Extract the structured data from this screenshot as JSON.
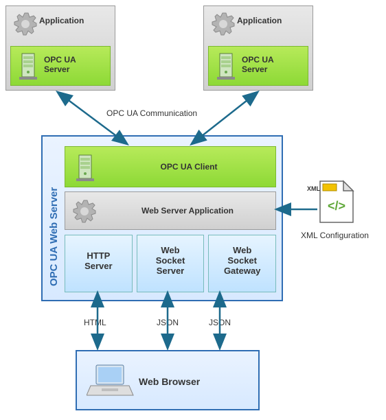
{
  "apps": [
    {
      "label": "Application",
      "server_label": "OPC UA\nServer"
    },
    {
      "label": "Application",
      "server_label": "OPC UA\nServer"
    }
  ],
  "communication_label": "OPC UA Communication",
  "main": {
    "side_title": "OPC UA Web Server",
    "client_label": "OPC UA Client",
    "webapp_label": "Web Server Application",
    "protocols": [
      {
        "name": "HTTP\nServer"
      },
      {
        "name": "Web\nSocket\nServer"
      },
      {
        "name": "Web\nSocket\nGateway"
      }
    ]
  },
  "config": {
    "tag": "XML",
    "label": "XML Configuration"
  },
  "transport_labels": [
    "HTML",
    "JSON",
    "JSON"
  ],
  "browser_label": "Web Browser",
  "colors": {
    "arrow": "#1d6a8c",
    "border_main": "#2f6db3",
    "green1": "#b7ea5a",
    "green2": "#8dd936"
  }
}
